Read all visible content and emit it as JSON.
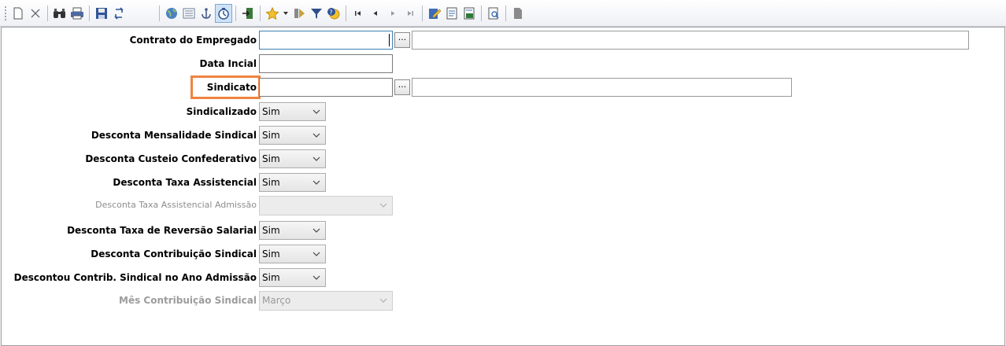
{
  "toolbar": {
    "icons": [
      "new-icon",
      "delete-icon",
      "find-icon",
      "print-icon",
      "save-icon",
      "refresh-icon",
      "globe-icon",
      "list-icon",
      "anchor-icon",
      "timer-icon",
      "exit-icon",
      "star-icon",
      "dropdown-icon",
      "forward-icon",
      "filter-icon",
      "help-icon",
      "first-icon",
      "prev-icon",
      "next-icon",
      "last-icon",
      "edit-icon",
      "report-icon",
      "export-icon",
      "preview-icon",
      "blank-icon"
    ]
  },
  "form": {
    "contrato": {
      "label": "Contrato do Empregado",
      "value": ""
    },
    "data_inicial": {
      "label": "Data Incial",
      "value": ""
    },
    "sindicato": {
      "label": "Sindicato",
      "value": "",
      "button": "..."
    },
    "sindicalizado": {
      "label": "Sindicalizado",
      "value": "Sim"
    },
    "mensalidade": {
      "label": "Desconta Mensalidade Sindical",
      "value": "Sim"
    },
    "custeio": {
      "label": "Desconta Custeio Confederativo",
      "value": "Sim"
    },
    "assistencial": {
      "label": "Desconta Taxa Assistencial",
      "value": "Sim"
    },
    "assistencial_admissao": {
      "label": "Desconta Taxa Assistencial Admissão",
      "value": ""
    },
    "reversao": {
      "label": "Desconta Taxa de Reversão Salarial",
      "value": "Sim"
    },
    "contribuicao": {
      "label": "Desconta Contribuição Sindical",
      "value": "Sim"
    },
    "contrib_ano": {
      "label": "Descontou Contrib. Sindical no Ano Admissão",
      "value": "Sim"
    },
    "mes_contribuicao": {
      "label": "Mês Contribuição Sindical",
      "value": "Março"
    },
    "contrato_button": "..."
  },
  "colors": {
    "highlight": "#f08340",
    "focus": "#3c7fb1"
  }
}
